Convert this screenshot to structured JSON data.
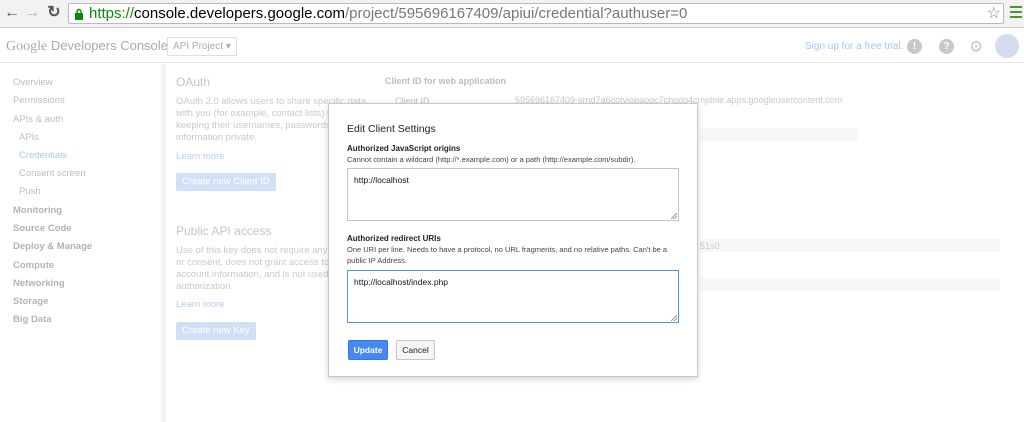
{
  "browser": {
    "url_scheme": "https://",
    "url_host": "console.developers.google.com",
    "url_path": "/project/595696167409/apiui/credential?authuser=0"
  },
  "header": {
    "logo_google": "Google",
    "logo_product": "Developers Console",
    "project_select": "API Project",
    "signup_text": "Sign up for a free trial.",
    "notification_icon": "!",
    "help_icon": "?"
  },
  "sidebar": {
    "items": [
      {
        "label": "Overview"
      },
      {
        "label": "Permissions"
      },
      {
        "label": "APIs & auth"
      },
      {
        "label": "APIs"
      },
      {
        "label": "Credentials"
      },
      {
        "label": "Consent screen"
      },
      {
        "label": "Push"
      },
      {
        "label": "Monitoring"
      },
      {
        "label": "Source Code"
      },
      {
        "label": "Deploy & Manage"
      },
      {
        "label": "Compute"
      },
      {
        "label": "Networking"
      },
      {
        "label": "Storage"
      },
      {
        "label": "Big Data"
      }
    ]
  },
  "main": {
    "oauth_title": "OAuth",
    "oauth_desc": [
      "OAuth 2.0 allows users to share specific data",
      "with you (for example, contact lists) while",
      "keeping their usernames, passwords, and other",
      "information private."
    ],
    "oauth_learn_more": "Learn more",
    "create_client_id": "Create new Client ID",
    "public_api_title": "Public API access",
    "public_api_desc": [
      "Use of this key does not require any user action",
      "or consent, does not grant access to any",
      "account information, and is not used for",
      "authorization."
    ],
    "public_learn_more": "Learn more",
    "create_key": "Create new Key",
    "client_section_title": "Client ID for web application",
    "client_id_label": "Client ID",
    "client_id_value": "595696167409-srnd7a6cotviopaooc7chodo4cmjdole.apps.googleusercontent.com",
    "key_fragment": "51s0"
  },
  "modal": {
    "title": "Edit Client Settings",
    "origins_label": "Authorized JavaScript origins",
    "origins_help": "Cannot contain a wildcard (http://*.example.com) or a path (http://example.com/subdir).",
    "origins_value": "http://localhost",
    "redirect_label": "Authorized redirect URIs",
    "redirect_help": "One URI per line. Needs to have a protocol, no URL fragments, and no relative paths. Can't be a public IP Address.",
    "redirect_value": "http://localhost/index.php",
    "update_button": "Update",
    "cancel_button": "Cancel"
  }
}
